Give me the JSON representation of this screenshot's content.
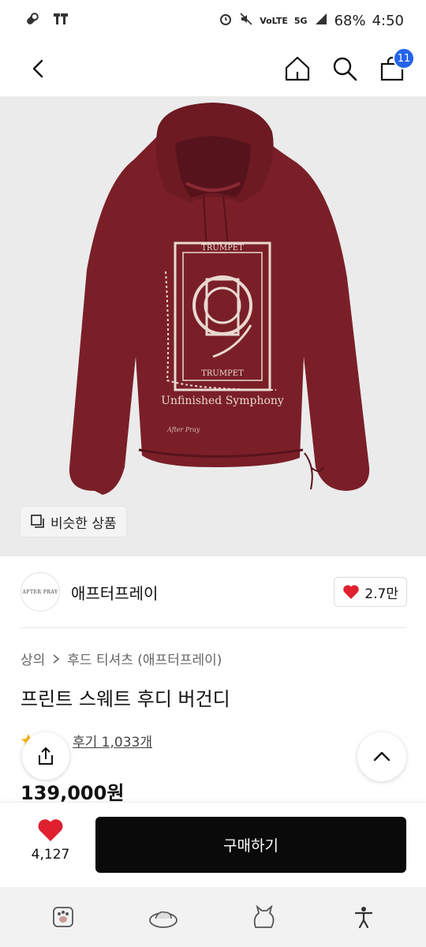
{
  "status_bar": {
    "battery": "68%",
    "time": "4:50",
    "network": "5G",
    "volte": "VoLTE"
  },
  "nav": {
    "cart_count": "11"
  },
  "image": {
    "print_top": "TRUMPET",
    "print_side": "TRUMPET",
    "print_caption": "Unfinished Symphony",
    "signature": "After Pray",
    "hoodie_color": "#7a1f28"
  },
  "similar": {
    "label": "비슷한 상품"
  },
  "brand": {
    "logo_text": "AFTER PRAY",
    "name": "애프터프레이",
    "likes": "2.7만"
  },
  "breadcrumb": {
    "category": "상의",
    "subcategory": "후드 티셔츠 (애프터프레이)"
  },
  "product": {
    "title": "프린트 스웨트 후디 버건디",
    "review_link": "후기 1,033개",
    "price": "139,000원"
  },
  "bottom": {
    "like_count": "4,127",
    "buy_label": "구매하기"
  },
  "colors": {
    "accent_badge": "#2563eb",
    "heart": "#e0202f",
    "buy_button": "#0a0a0a"
  }
}
